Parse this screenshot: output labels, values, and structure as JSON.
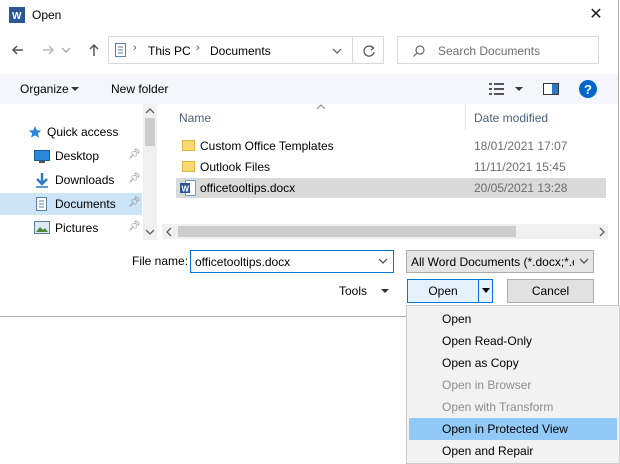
{
  "window": {
    "title": "Open",
    "app_icon": "word-icon"
  },
  "address": {
    "crumbs": [
      "This PC",
      "Documents"
    ]
  },
  "search": {
    "placeholder": "Search Documents"
  },
  "toolbar": {
    "organize": "Organize",
    "new_folder": "New folder"
  },
  "columns": {
    "name": "Name",
    "date": "Date modified"
  },
  "nav": [
    {
      "label": "Quick access",
      "icon": "star-icon"
    },
    {
      "label": "Desktop",
      "icon": "desktop-icon",
      "pinned": true
    },
    {
      "label": "Downloads",
      "icon": "download-icon",
      "pinned": true
    },
    {
      "label": "Documents",
      "icon": "documents-icon",
      "pinned": true,
      "selected": true
    },
    {
      "label": "Pictures",
      "icon": "pictures-icon",
      "pinned": true
    }
  ],
  "files": [
    {
      "name": "Custom Office Templates",
      "date": "18/01/2021 17:07",
      "type": "folder"
    },
    {
      "name": "Outlook Files",
      "date": "11/11/2021 15:45",
      "type": "folder"
    },
    {
      "name": "officetooltips.docx",
      "date": "20/05/2021 13:28",
      "type": "word",
      "selected": true
    }
  ],
  "footer": {
    "file_name_label": "File name:",
    "file_name_value": "officetooltips.docx",
    "file_type": "All Word Documents (*.docx;*.d",
    "tools": "Tools",
    "open": "Open",
    "cancel": "Cancel"
  },
  "open_menu": [
    {
      "label": "Open",
      "enabled": true
    },
    {
      "label": "Open Read-Only",
      "enabled": true
    },
    {
      "label": "Open as Copy",
      "enabled": true
    },
    {
      "label": "Open in Browser",
      "enabled": false
    },
    {
      "label": "Open with Transform",
      "enabled": false
    },
    {
      "label": "Open in Protected View",
      "enabled": true,
      "highlighted": true
    },
    {
      "label": "Open and Repair",
      "enabled": true
    }
  ],
  "colors": {
    "accent": "#0078d7",
    "selection": "#cce4f7",
    "menu_highlight": "#91c9f7",
    "help": "#0066cc"
  }
}
